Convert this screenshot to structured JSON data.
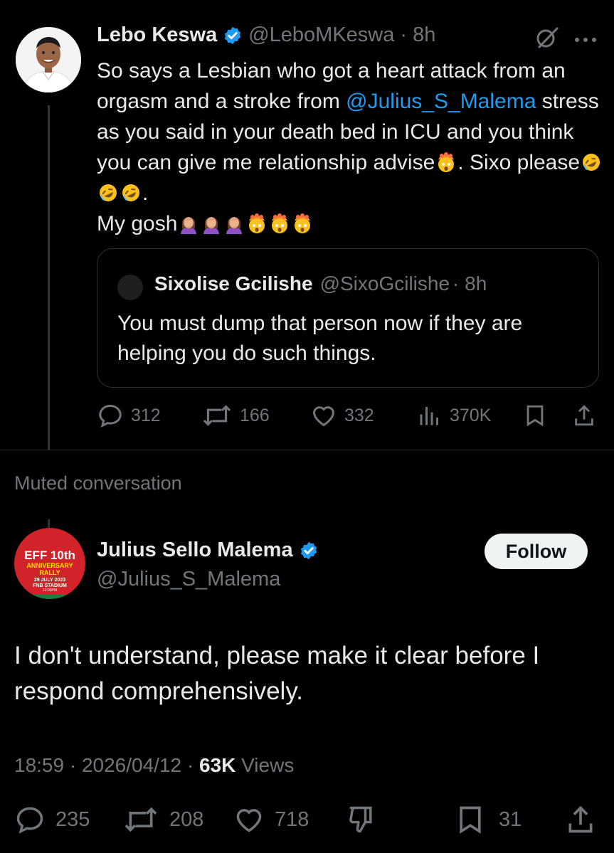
{
  "tweet1": {
    "author_name": "Lebo Keswa",
    "handle": "@LeboMKeswa",
    "time": "· 8h",
    "text_part1": "So says a Lesbian who got a heart attack from an orgasm and a stroke from ",
    "mention": "@Julius_S_Malema",
    "text_part2": " stress as you said in your death bed in ICU and you think you can give me relationship advise",
    "text_part3": ". Sixo please",
    "text_part4": ".",
    "text_part5": "My gosh",
    "quote": {
      "author_name": "Sixolise Gcilishe",
      "handle": "@SixoGcilishe",
      "time": "· 8h",
      "text": "You must dump that person now if they are helping you do such things."
    },
    "stats": {
      "replies": "312",
      "retweets": "166",
      "likes": "332",
      "views": "370K"
    }
  },
  "muted_label": "Muted conversation",
  "tweet2": {
    "author_name": "Julius Sello Malema",
    "handle": "@Julius_S_Malema",
    "follow_label": "Follow",
    "avatar_banner": {
      "line1": "EFF 10th",
      "line2": "ANNIVERSARY",
      "line3": "RALLY",
      "line4": "29 JULY 2023",
      "line5": "FNB STADIUM",
      "line6": "12:00PM"
    },
    "text": "I don't understand, please make it clear before I respond comprehensively.",
    "timestamp": "18:59 · 2026/04/12 ·",
    "views_count": "63K",
    "views_label": "Views",
    "stats": {
      "replies": "235",
      "retweets": "208",
      "likes": "718",
      "bookmarks": "31"
    }
  },
  "colors": {
    "background": "#000000",
    "text": "#e7e9ea",
    "muted": "#71767b",
    "link": "#1d9bf0",
    "verified": "#1d9bf0",
    "eff_red": "#d2232a"
  }
}
